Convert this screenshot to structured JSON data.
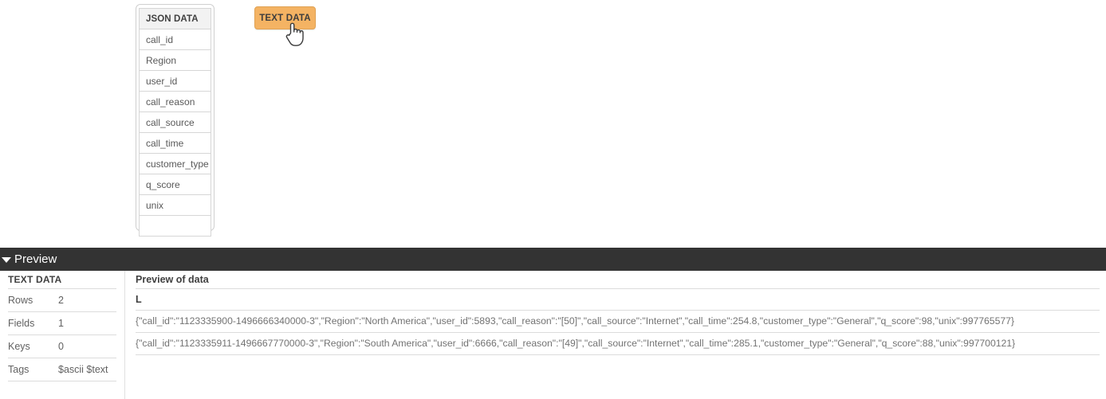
{
  "json_data_panel": {
    "header": "JSON DATA",
    "fields": [
      "call_id",
      "Region",
      "user_id",
      "call_reason",
      "call_source",
      "call_time",
      "customer_type",
      "q_score",
      "unix"
    ]
  },
  "text_data_button": {
    "label": "TEXT DATA",
    "fill_color": "#f4b363",
    "border_color": "#e0a254"
  },
  "preview_bar": {
    "label": "Preview",
    "background_color": "#333333",
    "caret_icon": "caret-down-icon"
  },
  "info_panel": {
    "title": "TEXT DATA",
    "rows": [
      {
        "key": "Rows",
        "value": "2"
      },
      {
        "key": "Fields",
        "value": "1"
      },
      {
        "key": "Keys",
        "value": "0"
      },
      {
        "key": "Tags",
        "value": "$ascii $text"
      }
    ]
  },
  "preview_table": {
    "title": "Preview of data",
    "columns": [
      "L"
    ],
    "rows": [
      "{\"call_id\":\"1123335900-1496666340000-3\",\"Region\":\"North America\",\"user_id\":5893,\"call_reason\":\"[50]\",\"call_source\":\"Internet\",\"call_time\":254.8,\"customer_type\":\"General\",\"q_score\":98,\"unix\":997765577}",
      "{\"call_id\":\"1123335911-1496667770000-3\",\"Region\":\"South America\",\"user_id\":6666,\"call_reason\":\"[49]\",\"call_source\":\"Internet\",\"call_time\":285.1,\"customer_type\":\"General\",\"q_score\":88,\"unix\":997700121}"
    ]
  }
}
